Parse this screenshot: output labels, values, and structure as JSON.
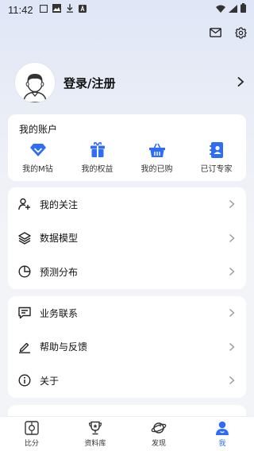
{
  "status_bar": {
    "time": "11:42"
  },
  "profile": {
    "login_label": "登录/注册"
  },
  "account": {
    "title": "我的账户",
    "items": [
      {
        "label": "我的M钻",
        "icon": "diamond-icon"
      },
      {
        "label": "我的权益",
        "icon": "gift-icon"
      },
      {
        "label": "我的已购",
        "icon": "basket-icon"
      },
      {
        "label": "已订专家",
        "icon": "contact-book-icon"
      }
    ]
  },
  "menu_group_1": [
    {
      "label": "我的关注",
      "icon": "user-add-icon"
    },
    {
      "label": "数据模型",
      "icon": "layers-icon"
    },
    {
      "label": "预测分布",
      "icon": "pie-chart-icon"
    }
  ],
  "menu_group_2": [
    {
      "label": "业务联系",
      "icon": "message-icon"
    },
    {
      "label": "帮助与反馈",
      "icon": "edit-icon"
    },
    {
      "label": "关于",
      "icon": "info-icon"
    }
  ],
  "tabbar": {
    "tabs": [
      {
        "label": "比分",
        "icon": "score-icon",
        "active": false
      },
      {
        "label": "资料库",
        "icon": "trophy-icon",
        "active": false
      },
      {
        "label": "发现",
        "icon": "planet-icon",
        "active": false
      },
      {
        "label": "我",
        "icon": "person-icon",
        "active": true
      }
    ]
  },
  "colors": {
    "accent": "#2f6df6",
    "background": "#f3f4f8"
  }
}
